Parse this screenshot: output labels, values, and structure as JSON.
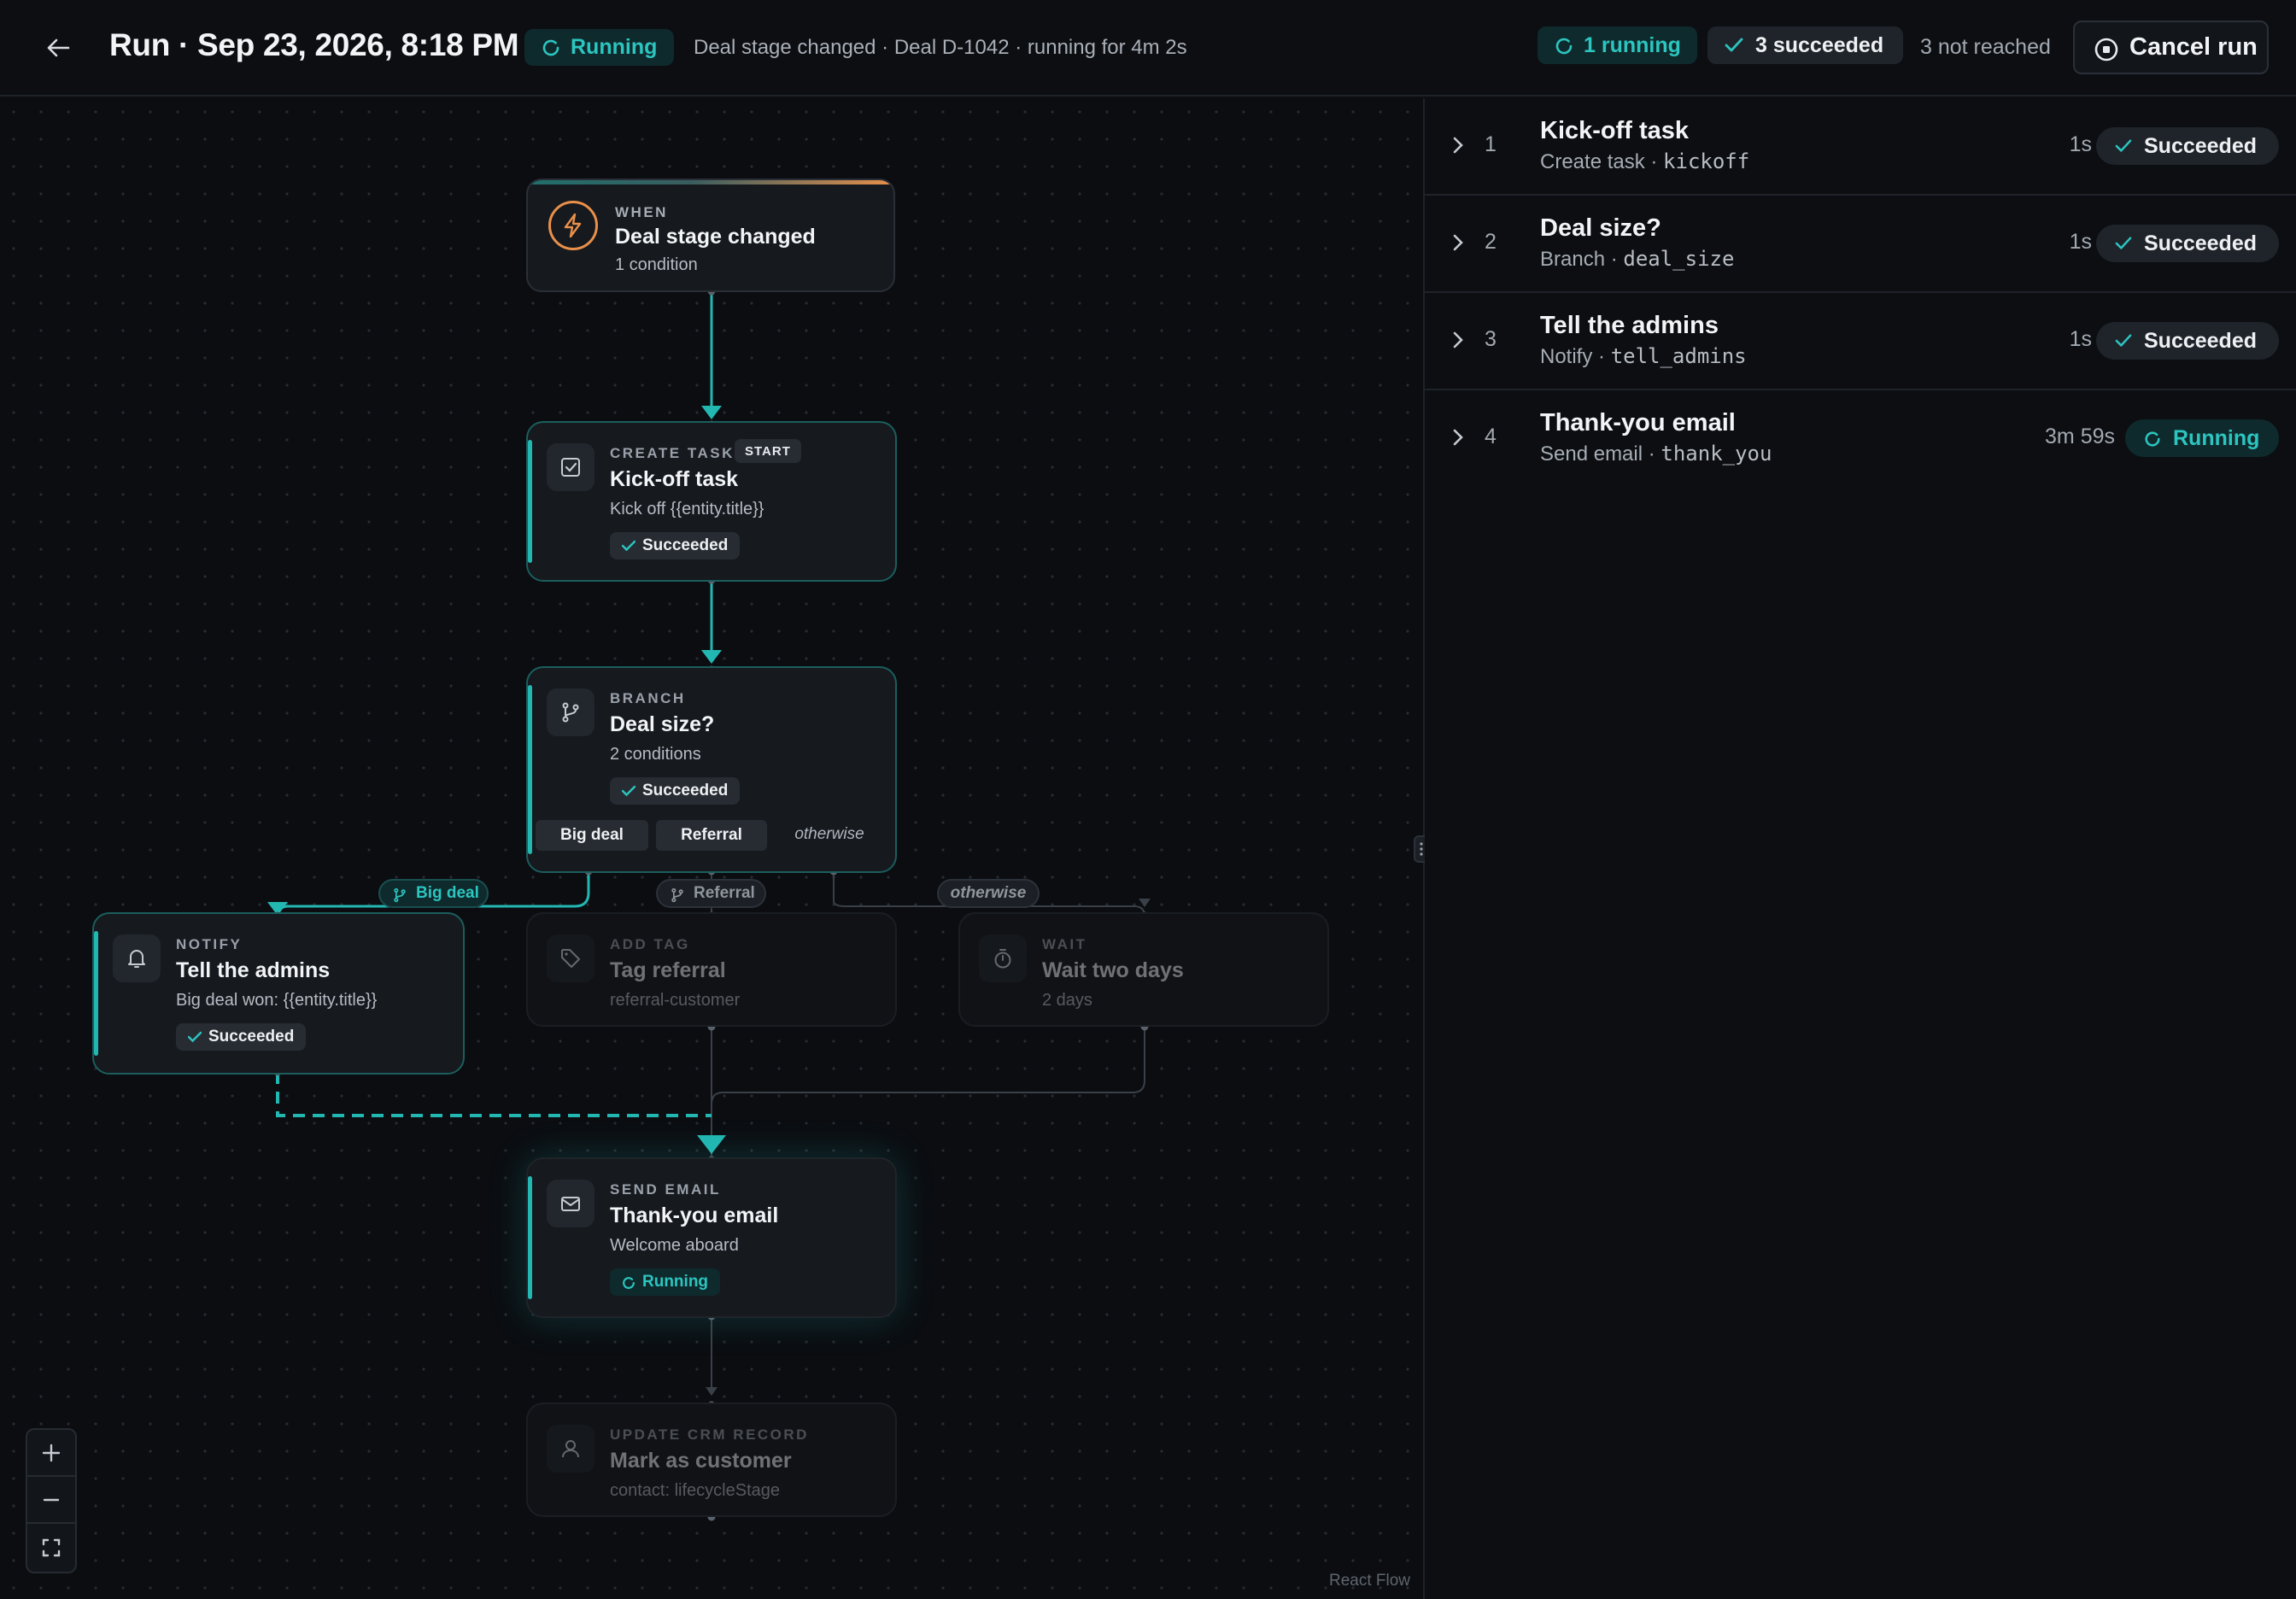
{
  "header": {
    "title": "Run · Sep 23, 2026, 8:18 PM",
    "status": "Running",
    "subtitle": "Deal stage changed · Deal D-1042 · running for 4m 2s",
    "running_count": "1 running",
    "succeeded_count": "3 succeeded",
    "not_reached": "3 not reached",
    "cancel_label": "Cancel run"
  },
  "colors": {
    "accent": "#23b7b2",
    "running": "#2cc5c0",
    "trigger": "#e8904a",
    "background": "#0b0d11"
  },
  "flow": {
    "trigger": {
      "kind": "WHEN",
      "title": "Deal stage changed",
      "desc": "1 condition",
      "icon": "lightning-icon"
    },
    "kickoff": {
      "kind": "CREATE TASK",
      "tag": "START",
      "title": "Kick-off task",
      "desc": "Kick off {{entity.title}}",
      "status": "Succeeded",
      "icon": "checkbox-icon"
    },
    "branch": {
      "kind": "BRANCH",
      "title": "Deal size?",
      "desc": "2 conditions",
      "status": "Succeeded",
      "icon": "git-branch-icon",
      "outputs": [
        "Big deal",
        "Referral"
      ],
      "otherwise": "otherwise"
    },
    "notify": {
      "kind": "NOTIFY",
      "title": "Tell the admins",
      "desc": "Big deal won: {{entity.title}}",
      "status": "Succeeded",
      "icon": "bell-icon"
    },
    "tag": {
      "kind": "ADD TAG",
      "title": "Tag referral",
      "desc": "referral-customer",
      "icon": "tag-icon"
    },
    "wait": {
      "kind": "WAIT",
      "title": "Wait two days",
      "desc": "2 days",
      "icon": "stopwatch-icon"
    },
    "email": {
      "kind": "SEND EMAIL",
      "title": "Thank-you email",
      "desc": "Welcome aboard",
      "status": "Running",
      "icon": "mail-icon"
    },
    "crm": {
      "kind": "UPDATE CRM RECORD",
      "title": "Mark as customer",
      "desc": "contact: lifecycleStage",
      "icon": "user-icon"
    },
    "edge_labels": {
      "big": "Big deal",
      "ref": "Referral",
      "other": "otherwise"
    }
  },
  "canvas": {
    "attribution": "React Flow"
  },
  "steps": [
    {
      "num": "1",
      "name": "Kick-off task",
      "type": "Create task",
      "key": "kickoff",
      "duration": "1s",
      "status": "Succeeded"
    },
    {
      "num": "2",
      "name": "Deal size?",
      "type": "Branch",
      "key": "deal_size",
      "duration": "1s",
      "status": "Succeeded"
    },
    {
      "num": "3",
      "name": "Tell the admins",
      "type": "Notify",
      "key": "tell_admins",
      "duration": "1s",
      "status": "Succeeded"
    },
    {
      "num": "4",
      "name": "Thank-you email",
      "type": "Send email",
      "key": "thank_you",
      "duration": "3m 59s",
      "status": "Running"
    }
  ]
}
